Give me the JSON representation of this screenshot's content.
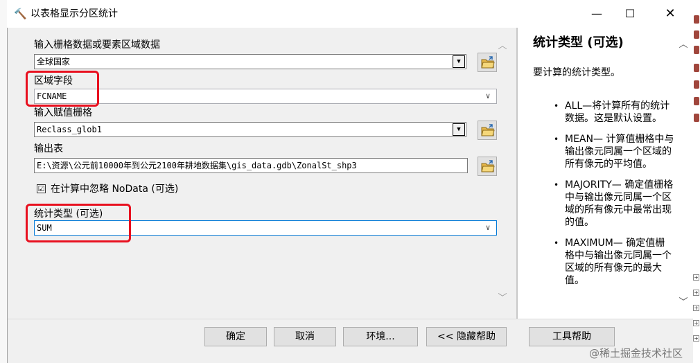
{
  "window": {
    "title": "以表格显示分区统计",
    "icon": "hammer-icon",
    "minimize": "—",
    "maximize": "☐",
    "close": "✕"
  },
  "form": {
    "input_label": "输入栅格数据或要素区域数据",
    "input_value": "全球国家",
    "zone_field_label": "区域字段",
    "zone_field_value": "FCNAME",
    "value_raster_label": "输入赋值栅格",
    "value_raster_value": "Reclass_glob1",
    "output_label": "输出表",
    "output_value": "E:\\资源\\公元前10000年到公元2100年耕地数据集\\gis_data.gdb\\ZonalSt_shp3",
    "ignore_nodata_label": "在计算中忽略 NoData (可选)",
    "ignore_nodata_checked": "☑",
    "stat_type_label": "统计类型 (可选)",
    "stat_type_value": "SUM"
  },
  "help": {
    "title": "统计类型 (可选)",
    "intro": "要计算的统计类型。",
    "items": [
      "ALL—将计算所有的统计数据。这是默认设置。",
      "MEAN— 计算值栅格中与输出像元同属一个区域的所有像元的平均值。",
      "MAJORITY— 确定值栅格中与输出像元同属一个区域的所有像元中最常出现的值。",
      "MAXIMUM— 确定值栅格中与输出像元同属一个区域的所有像元的最大值。"
    ],
    "bullet": "•"
  },
  "buttons": {
    "ok": "确定",
    "cancel": "取消",
    "environments": "环境...",
    "hide_help": "<< 隐藏帮助",
    "tool_help": "工具帮助"
  },
  "watermark": "@稀土掘金技术社区",
  "scroll": {
    "up": "︿",
    "down": "﹀"
  },
  "colors": {
    "highlight_box": "#e8101f",
    "focus_border": "#0078d7"
  }
}
